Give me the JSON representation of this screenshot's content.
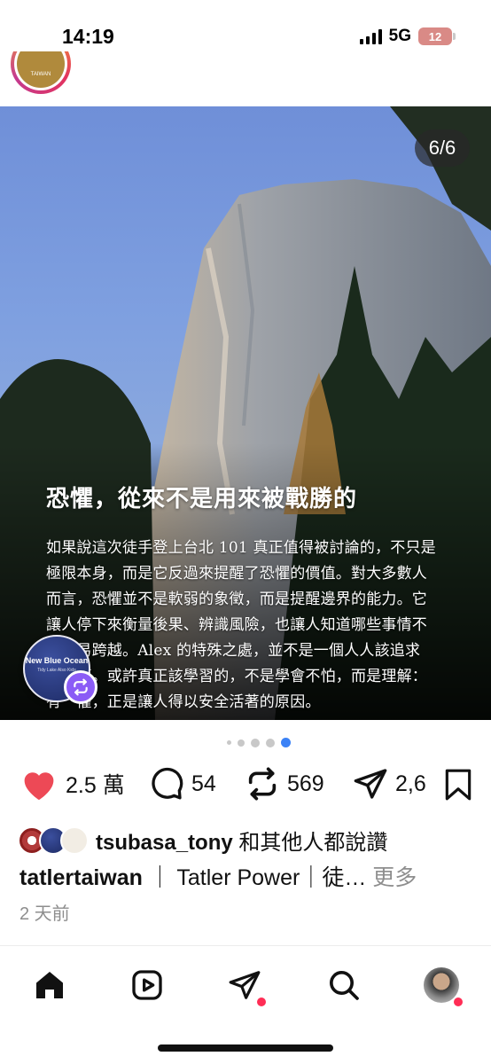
{
  "status": {
    "time": "14:19",
    "network": "5G",
    "battery": "12"
  },
  "post": {
    "image_counter": "6/6",
    "overlay_title": "恐懼，從來不是用來被戰勝的",
    "overlay_lines": [
      "如果說這次徒手登上台北 101 真正值得被討論的，不只是",
      "極限本身，而是它反過來提醒了恐懼的價值。對大多數人",
      "而言，恐懼並不是軟弱的象徵，而是提醒邊界的能力。它",
      "讓人停下來衡量後果、辨識風險，也讓人知道哪些事情不",
      "　　易跨越。Alex 的特殊之處，並不是一個人人該追求",
      "　　範。或許真正該學習的，不是學會不怕，而是理解：",
      "有　懼，正是讓人得以安全活著的原因。"
    ],
    "floating_widget": {
      "title": "New Blue Ocean",
      "subtitle": "Tidy Lake Also Kids"
    },
    "likes": "2.5 萬",
    "comments": "54",
    "reposts": "569",
    "shares": "2,6",
    "liked_by_user": "tsubasa_tony",
    "liked_by_suffix": " 和其他人都說讚",
    "author": "tatlertaiwan",
    "caption": "｜ Tatler Power｜徒…",
    "more_label": " 更多",
    "posted_ago": "2 天前",
    "avatar_label": "TAIWAN"
  },
  "nav": {
    "items": [
      "home-icon",
      "reels-icon",
      "send-icon",
      "search-icon",
      "profile-avatar"
    ]
  },
  "colors": {
    "like_red": "#ed4956",
    "notify_red": "#ff2d55",
    "widget_badge": "#8b5cf6"
  }
}
